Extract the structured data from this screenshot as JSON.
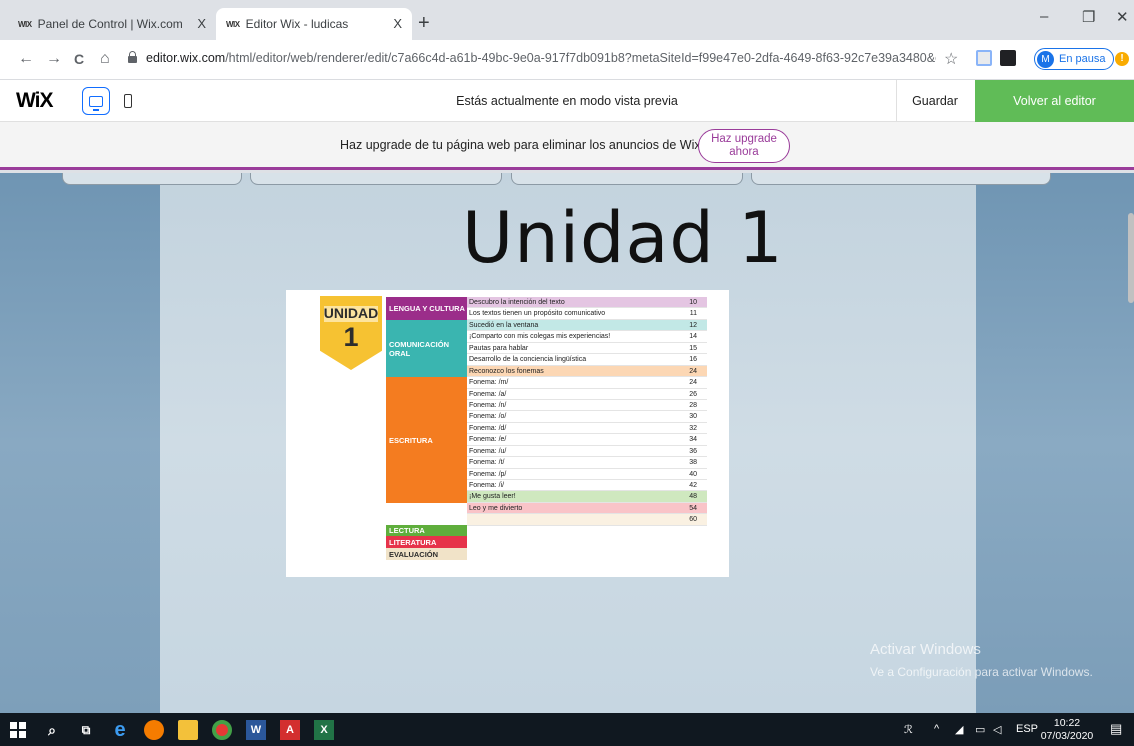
{
  "browser": {
    "tabs": [
      {
        "favicon": "WIX",
        "title": "Panel de Control | Wix.com",
        "close": "X"
      },
      {
        "favicon": "WIX",
        "title": "Editor Wix - ludicas",
        "close": "X"
      }
    ],
    "new_tab": "+",
    "window_controls": {
      "minimize": "–",
      "restore": "❐",
      "close": "✕"
    },
    "nav": {
      "back": "←",
      "forward": "→",
      "reload": "C",
      "home": "⌂"
    },
    "url_host": "editor.wix.com",
    "url_path": "/html/editor/web/renderer/edit/c7a66c4d-a61b-49bc-9e0a-917f7db091b8?metaSiteId=f99e47e0-2dfa-4649-8f63-92c7e39a3480&edit...",
    "bookmark": "☆",
    "profile": {
      "initial": "M",
      "label": "En pausa"
    },
    "alert": "!"
  },
  "wix": {
    "logo": "WiX",
    "preview_message": "Estás actualmente en modo vista previa",
    "save_label": "Guardar",
    "back_label": "Volver al editor",
    "upgrade_text": "Haz upgrade de tu página web para eliminar los anuncios de Wix",
    "upgrade_button_line1": "Haz upgrade",
    "upgrade_button_line2": "ahora"
  },
  "site": {
    "title": "Unidad 1",
    "badge_word": "UNIDAD",
    "badge_number": "1",
    "sections": [
      {
        "label": "LENGUA Y CULTURA",
        "color": "#9b2d8a"
      },
      {
        "label": "COMUNICACIÓN ORAL",
        "color": "#3ab5b0"
      },
      {
        "label": "ESCRITURA",
        "color": "#f47c20"
      },
      {
        "label": "LECTURA",
        "color": "#5fae3c"
      },
      {
        "label": "LITERATURA",
        "color": "#e6334a"
      },
      {
        "label": "EVALUACIÓN",
        "color": "#f1e3c8"
      }
    ],
    "rows": [
      {
        "title": "Descubro la intención del texto",
        "page": "10",
        "bg": "#e4c5e2"
      },
      {
        "title": "Los textos tienen un propósito comunicativo",
        "page": "11",
        "bg": "#ffffff"
      },
      {
        "title": "Sucedió en la ventana",
        "page": "12",
        "bg": "#c2e8e6"
      },
      {
        "title": "¡Comparto con mis colegas mis experiencias!",
        "page": "14",
        "bg": "#ffffff"
      },
      {
        "title": "Pautas para hablar",
        "page": "15",
        "bg": "#ffffff"
      },
      {
        "title": "Desarrollo de la conciencia lingüística",
        "page": "16",
        "bg": "#ffffff"
      },
      {
        "title": "Reconozco los fonemas",
        "page": "24",
        "bg": "#fcd7b4"
      },
      {
        "title": "Fonema: /m/",
        "page": "24",
        "bg": "#ffffff"
      },
      {
        "title": "Fonema: /a/",
        "page": "26",
        "bg": "#ffffff"
      },
      {
        "title": "Fonema: /n/",
        "page": "28",
        "bg": "#ffffff"
      },
      {
        "title": "Fonema: /o/",
        "page": "30",
        "bg": "#ffffff"
      },
      {
        "title": "Fonema: /d/",
        "page": "32",
        "bg": "#ffffff"
      },
      {
        "title": "Fonema: /e/",
        "page": "34",
        "bg": "#ffffff"
      },
      {
        "title": "Fonema: /u/",
        "page": "36",
        "bg": "#ffffff"
      },
      {
        "title": "Fonema: /t/",
        "page": "38",
        "bg": "#ffffff"
      },
      {
        "title": "Fonema: /p/",
        "page": "40",
        "bg": "#ffffff"
      },
      {
        "title": "Fonema: /i/",
        "page": "42",
        "bg": "#ffffff"
      },
      {
        "title": "¡Me gusta leer!",
        "page": "48",
        "bg": "#cfe8bf"
      },
      {
        "title": "Leo y me divierto",
        "page": "54",
        "bg": "#f9c4c8"
      },
      {
        "title": "",
        "page": "60",
        "bg": "#faf1e2"
      }
    ]
  },
  "watermark": {
    "line1": "Activar Windows",
    "line2": "Ve a Configuración para activar Windows."
  },
  "taskbar": {
    "ime": "ESP",
    "time": "10:22",
    "date": "07/03/2020"
  }
}
